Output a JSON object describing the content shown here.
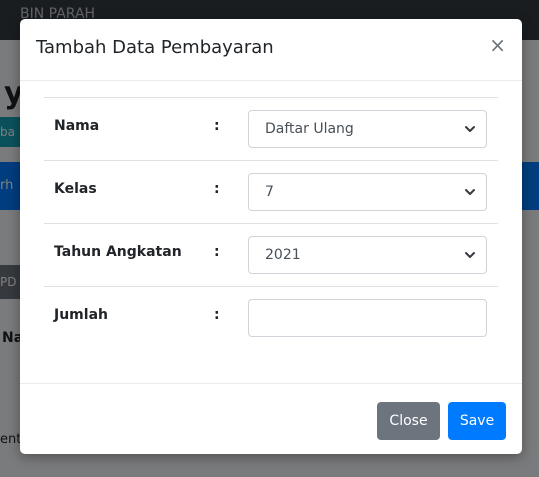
{
  "background": {
    "navbar_text": "BIN PARAH",
    "heading": "ya",
    "teal_btn_text": "ba",
    "blue_bar_text": "rh",
    "gray_btn_text": "PD",
    "table_header_text": "Na",
    "footer_text": "ent"
  },
  "modal": {
    "title": "Tambah Data Pembayaran",
    "close_symbol": "×",
    "fields": [
      {
        "label": "Nama",
        "colon": ":",
        "value": "Daftar Ulang",
        "type": "select"
      },
      {
        "label": "Kelas",
        "colon": ":",
        "value": "7",
        "type": "select"
      },
      {
        "label": "Tahun Angkatan",
        "colon": ":",
        "value": "2021",
        "type": "select"
      },
      {
        "label": "Jumlah",
        "colon": ":",
        "value": "",
        "type": "input"
      }
    ],
    "close_label": "Close",
    "save_label": "Save"
  },
  "colors": {
    "primary": "#007bff",
    "secondary": "#6c757d",
    "info": "#17a2b8"
  }
}
